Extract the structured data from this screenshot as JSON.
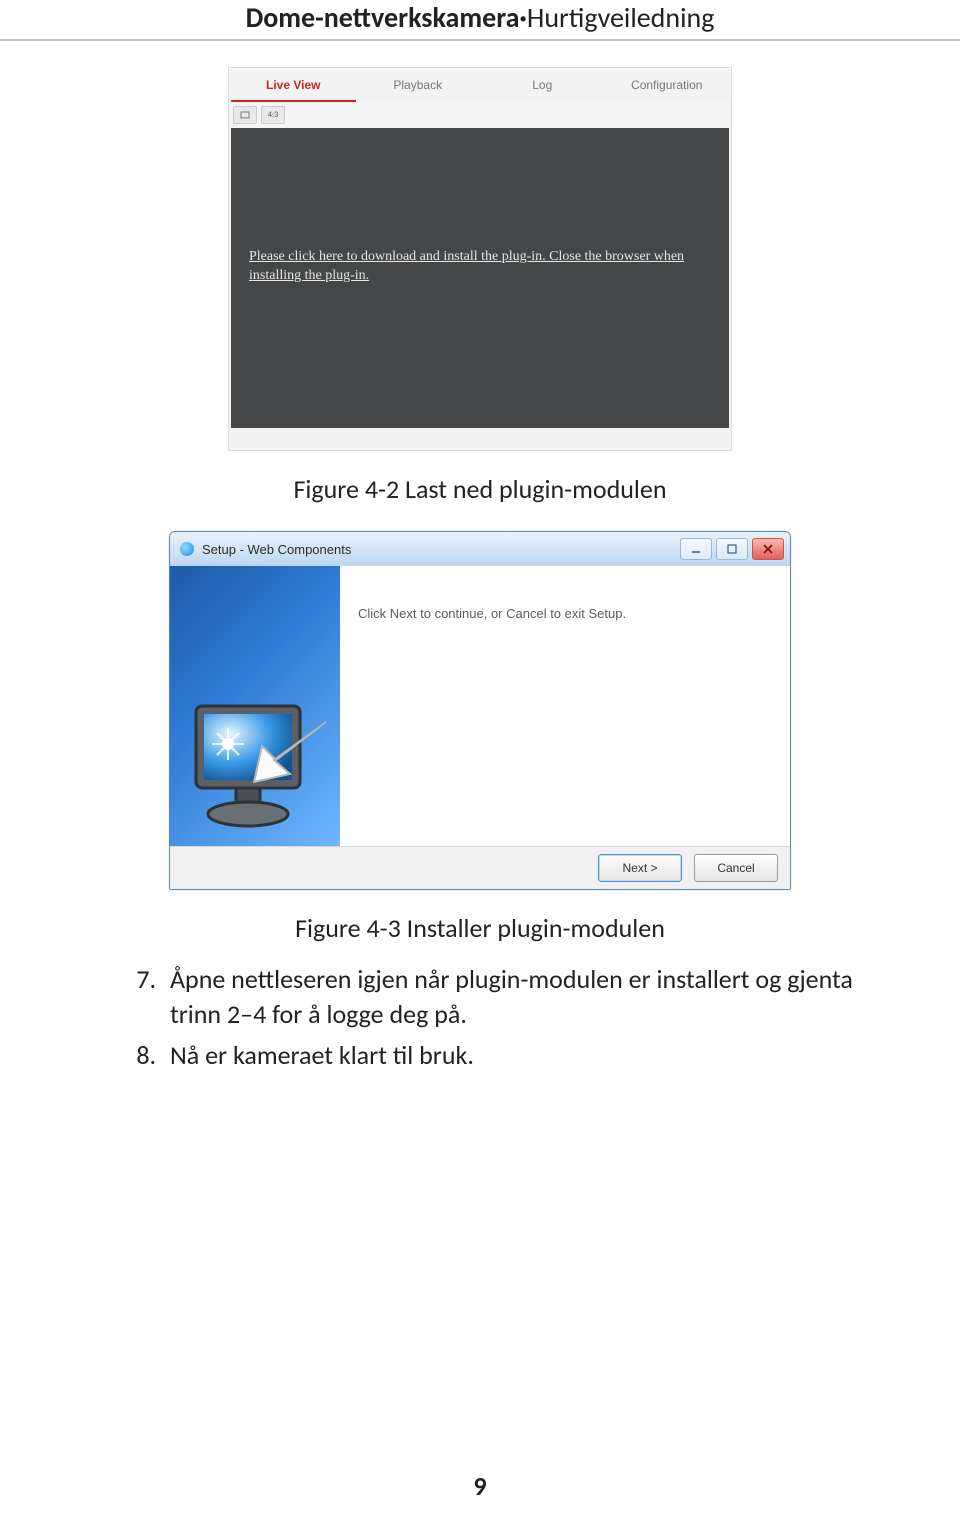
{
  "header": {
    "bold": "Dome-nettverkskamera·",
    "light": "Hurtigveiledning"
  },
  "webui": {
    "tabs": [
      "Live View",
      "Playback",
      "Log",
      "Configuration"
    ],
    "toolbar_btn2": "4:3",
    "message": "Please click here to download and install the plug-in. Close the browser when installing the plug-in."
  },
  "caption1": "Figure 4-2 Last ned plugin-modulen",
  "dialog": {
    "title": "Setup - Web Components",
    "content": "Click Next to continue, or Cancel to exit Setup.",
    "next": "Next >",
    "cancel": "Cancel"
  },
  "caption2": "Figure 4-3 Installer plugin-modulen",
  "steps": {
    "s7": "Åpne nettleseren igjen når plugin-modulen er installert og gjenta trinn 2–4 for å logge deg på.",
    "s8": "Nå er kameraet klart til bruk."
  },
  "page_number": "9"
}
